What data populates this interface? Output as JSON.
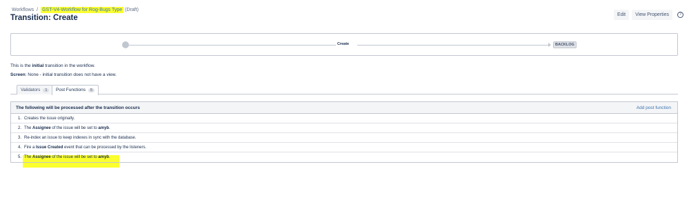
{
  "breadcrumb": {
    "root": "Workflows",
    "separator": "/",
    "workflow_name": "GST-V4-Workflow for Rog-Bugs Type",
    "state": "(Draft)"
  },
  "page_title": "Transition: Create",
  "actions": {
    "edit_label": "Edit",
    "view_properties_label": "View Properties",
    "help_icon": "?"
  },
  "diagram": {
    "transition_label": "Create",
    "target_status": "BACKLOG"
  },
  "info": {
    "line1_prefix": "This is the ",
    "line1_bold": "initial",
    "line1_suffix": " transition in the workflow.",
    "line2_bold": "Screen",
    "line2_rest": ": None - initial transition does not have a view."
  },
  "tabs": [
    {
      "label": "Validators",
      "count": "1"
    },
    {
      "label": "Post Functions",
      "count": "5"
    }
  ],
  "panel": {
    "title": "The following will be processed after the transition occurs",
    "add_link": "Add post function"
  },
  "post_functions": [
    {
      "num": "1.",
      "a": "Creates the issue originally.",
      "b": "",
      "c": "",
      "d": "",
      "e": ""
    },
    {
      "num": "2.",
      "a": "The ",
      "b": "Assignee",
      "c": " of the issue will be set to ",
      "d": "amyb",
      "e": "."
    },
    {
      "num": "3.",
      "a": "Re-index an issue to keep indexes in sync with the database.",
      "b": "",
      "c": "",
      "d": "",
      "e": ""
    },
    {
      "num": "4.",
      "a": "Fire a ",
      "b": "Issue Created",
      "c": " event that can be processed by the listeners.",
      "d": "",
      "e": ""
    },
    {
      "num": "5.",
      "a": "The ",
      "b": "Assignee",
      "c": " of the issue will be set to ",
      "d": "amyb",
      "e": "."
    }
  ],
  "colors": {
    "highlight": "#fbff2e",
    "link": "#3b73af"
  }
}
